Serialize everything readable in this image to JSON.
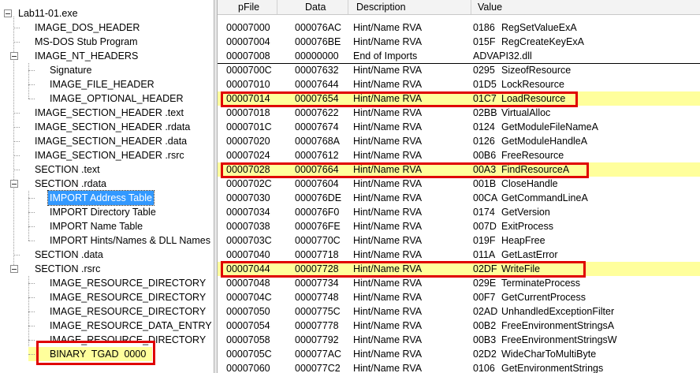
{
  "tree": {
    "items": [
      {
        "label": "Lab11-01.exe",
        "selected": false
      },
      {
        "label": "IMAGE_DOS_HEADER",
        "selected": false
      },
      {
        "label": "MS-DOS Stub Program",
        "selected": false
      },
      {
        "label": "IMAGE_NT_HEADERS",
        "selected": false
      },
      {
        "label": "Signature",
        "selected": false
      },
      {
        "label": "IMAGE_FILE_HEADER",
        "selected": false
      },
      {
        "label": "IMAGE_OPTIONAL_HEADER",
        "selected": false
      },
      {
        "label": "IMAGE_SECTION_HEADER .text",
        "selected": false
      },
      {
        "label": "IMAGE_SECTION_HEADER .rdata",
        "selected": false
      },
      {
        "label": "IMAGE_SECTION_HEADER .data",
        "selected": false
      },
      {
        "label": "IMAGE_SECTION_HEADER .rsrc",
        "selected": false
      },
      {
        "label": "SECTION .text",
        "selected": false
      },
      {
        "label": "SECTION .rdata",
        "selected": false
      },
      {
        "label": "IMPORT Address Table",
        "selected": true
      },
      {
        "label": "IMPORT Directory Table",
        "selected": false
      },
      {
        "label": "IMPORT Name Table",
        "selected": false
      },
      {
        "label": "IMPORT Hints/Names & DLL Names",
        "selected": false
      },
      {
        "label": "SECTION .data",
        "selected": false
      },
      {
        "label": "SECTION .rsrc",
        "selected": false
      },
      {
        "label": "IMAGE_RESOURCE_DIRECTORY",
        "selected": false
      },
      {
        "label": "IMAGE_RESOURCE_DIRECTORY",
        "selected": false
      },
      {
        "label": "IMAGE_RESOURCE_DIRECTORY",
        "selected": false
      },
      {
        "label": "IMAGE_RESOURCE_DATA_ENTRY",
        "selected": false
      },
      {
        "label": "IMAGE_RESOURCE_DIRECTORY",
        "selected": false
      },
      {
        "label": "BINARY  TGAD  0000",
        "selected": false
      }
    ]
  },
  "grid": {
    "columns": [
      "pFile",
      "Data",
      "Description",
      "Value"
    ],
    "rows": [
      {
        "pfile": "00007000",
        "data": "000076AC",
        "desc": "Hint/Name RVA",
        "hint": "0186",
        "name": "RegSetValueExA",
        "highlight": false
      },
      {
        "pfile": "00007004",
        "data": "000076BE",
        "desc": "Hint/Name RVA",
        "hint": "015F",
        "name": "RegCreateKeyExA",
        "highlight": false
      },
      {
        "pfile": "00007008",
        "data": "00000000",
        "desc": "End of Imports",
        "hint": "ADVAPI32.dll",
        "name": "",
        "highlight": false
      },
      {
        "pfile": "0000700C",
        "data": "00007632",
        "desc": "Hint/Name RVA",
        "hint": "0295",
        "name": "SizeofResource",
        "highlight": false
      },
      {
        "pfile": "00007010",
        "data": "00007644",
        "desc": "Hint/Name RVA",
        "hint": "01D5",
        "name": "LockResource",
        "highlight": false
      },
      {
        "pfile": "00007014",
        "data": "00007654",
        "desc": "Hint/Name RVA",
        "hint": "01C7",
        "name": "LoadResource",
        "highlight": true
      },
      {
        "pfile": "00007018",
        "data": "00007622",
        "desc": "Hint/Name RVA",
        "hint": "02BB",
        "name": "VirtualAlloc",
        "highlight": false
      },
      {
        "pfile": "0000701C",
        "data": "00007674",
        "desc": "Hint/Name RVA",
        "hint": "0124",
        "name": "GetModuleFileNameA",
        "highlight": false
      },
      {
        "pfile": "00007020",
        "data": "0000768A",
        "desc": "Hint/Name RVA",
        "hint": "0126",
        "name": "GetModuleHandleA",
        "highlight": false
      },
      {
        "pfile": "00007024",
        "data": "00007612",
        "desc": "Hint/Name RVA",
        "hint": "00B6",
        "name": "FreeResource",
        "highlight": false
      },
      {
        "pfile": "00007028",
        "data": "00007664",
        "desc": "Hint/Name RVA",
        "hint": "00A3",
        "name": "FindResourceA",
        "highlight": true
      },
      {
        "pfile": "0000702C",
        "data": "00007604",
        "desc": "Hint/Name RVA",
        "hint": "001B",
        "name": "CloseHandle",
        "highlight": false
      },
      {
        "pfile": "00007030",
        "data": "000076DE",
        "desc": "Hint/Name RVA",
        "hint": "00CA",
        "name": "GetCommandLineA",
        "highlight": false
      },
      {
        "pfile": "00007034",
        "data": "000076F0",
        "desc": "Hint/Name RVA",
        "hint": "0174",
        "name": "GetVersion",
        "highlight": false
      },
      {
        "pfile": "00007038",
        "data": "000076FE",
        "desc": "Hint/Name RVA",
        "hint": "007D",
        "name": "ExitProcess",
        "highlight": false
      },
      {
        "pfile": "0000703C",
        "data": "0000770C",
        "desc": "Hint/Name RVA",
        "hint": "019F",
        "name": "HeapFree",
        "highlight": false
      },
      {
        "pfile": "00007040",
        "data": "00007718",
        "desc": "Hint/Name RVA",
        "hint": "011A",
        "name": "GetLastError",
        "highlight": false
      },
      {
        "pfile": "00007044",
        "data": "00007728",
        "desc": "Hint/Name RVA",
        "hint": "02DF",
        "name": "WriteFile",
        "highlight": true
      },
      {
        "pfile": "00007048",
        "data": "00007734",
        "desc": "Hint/Name RVA",
        "hint": "029E",
        "name": "TerminateProcess",
        "highlight": false
      },
      {
        "pfile": "0000704C",
        "data": "00007748",
        "desc": "Hint/Name RVA",
        "hint": "00F7",
        "name": "GetCurrentProcess",
        "highlight": false
      },
      {
        "pfile": "00007050",
        "data": "0000775C",
        "desc": "Hint/Name RVA",
        "hint": "02AD",
        "name": "UnhandledExceptionFilter",
        "highlight": false
      },
      {
        "pfile": "00007054",
        "data": "00007778",
        "desc": "Hint/Name RVA",
        "hint": "00B2",
        "name": "FreeEnvironmentStringsA",
        "highlight": false
      },
      {
        "pfile": "00007058",
        "data": "00007792",
        "desc": "Hint/Name RVA",
        "hint": "00B3",
        "name": "FreeEnvironmentStringsW",
        "highlight": false
      },
      {
        "pfile": "0000705C",
        "data": "000077AC",
        "desc": "Hint/Name RVA",
        "hint": "02D2",
        "name": "WideCharToMultiByte",
        "highlight": false
      },
      {
        "pfile": "00007060",
        "data": "000077C2",
        "desc": "Hint/Name RVA",
        "hint": "0106",
        "name": "GetEnvironmentStrings",
        "highlight": false
      }
    ]
  },
  "colors": {
    "highlight": "#ffff9c",
    "selection": "#3399ff",
    "annotation_box": "#e00000"
  }
}
